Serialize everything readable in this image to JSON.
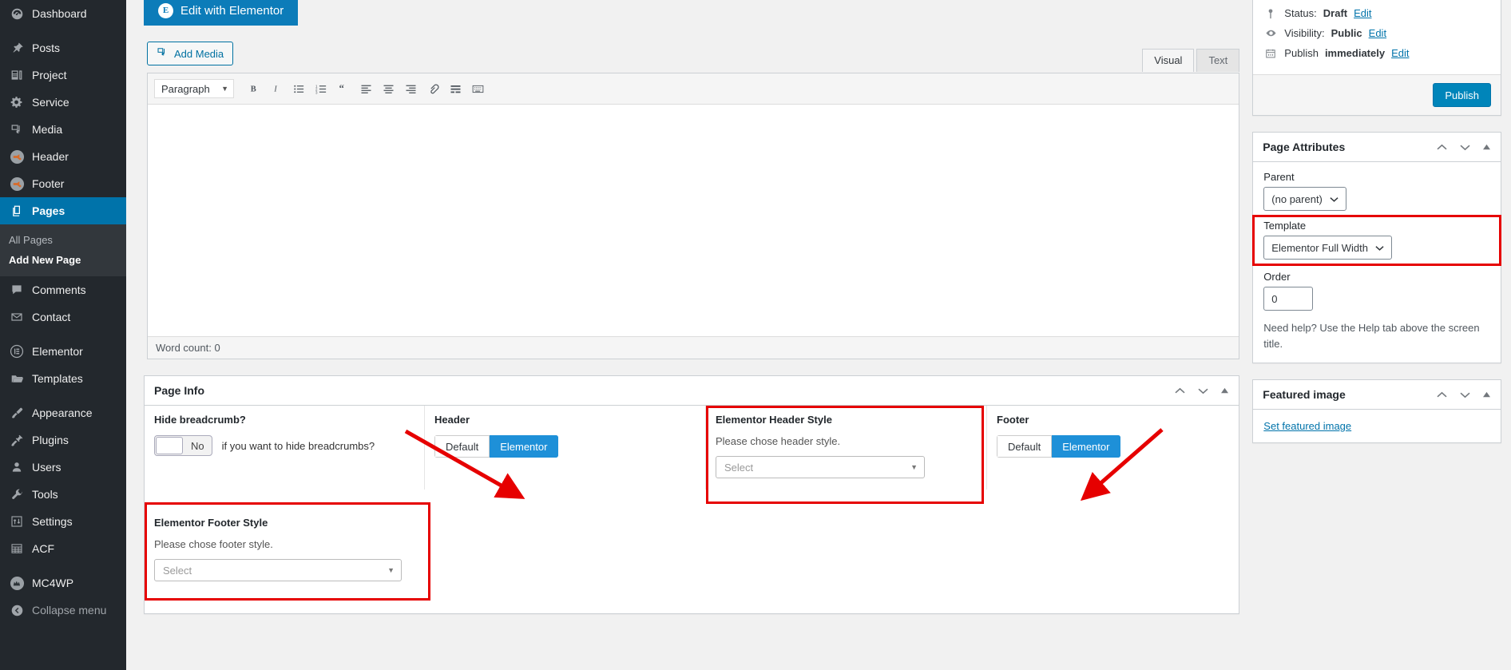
{
  "sidebar": {
    "items": [
      {
        "label": "Dashboard",
        "icon": "dashboard-icon",
        "gap_after": true
      },
      {
        "label": "Posts",
        "icon": "pin-icon"
      },
      {
        "label": "Project",
        "icon": "list-view-icon"
      },
      {
        "label": "Service",
        "icon": "gear-icon"
      },
      {
        "label": "Media",
        "icon": "media-icon"
      },
      {
        "label": "Header",
        "icon": "megaphone-icon"
      },
      {
        "label": "Footer",
        "icon": "megaphone-icon"
      },
      {
        "label": "Pages",
        "icon": "pages-icon",
        "active": true
      },
      {
        "label": "Comments",
        "icon": "comment-icon"
      },
      {
        "label": "Contact",
        "icon": "email-icon",
        "gap_after": true
      },
      {
        "label": "Elementor",
        "icon": "elementor-icon"
      },
      {
        "label": "Templates",
        "icon": "folder-icon",
        "gap_after": true
      },
      {
        "label": "Appearance",
        "icon": "brush-icon"
      },
      {
        "label": "Plugins",
        "icon": "plug-icon"
      },
      {
        "label": "Users",
        "icon": "user-icon"
      },
      {
        "label": "Tools",
        "icon": "wrench-icon"
      },
      {
        "label": "Settings",
        "icon": "settings-sliders-icon"
      },
      {
        "label": "ACF",
        "icon": "table-icon",
        "gap_after": true
      },
      {
        "label": "MC4WP",
        "icon": "mailchimp-icon"
      },
      {
        "label": "Collapse menu",
        "icon": "collapse-arrow-icon",
        "muted": true
      }
    ],
    "submenu": {
      "parent": "Pages",
      "items": [
        {
          "label": "All Pages",
          "current": false
        },
        {
          "label": "Add New Page",
          "current": true
        }
      ]
    }
  },
  "toolbar": {
    "edit_with_elementor": "Edit with Elementor",
    "elementor_mark": "E",
    "add_media": "Add Media"
  },
  "editor": {
    "tabs": [
      {
        "label": "Visual",
        "active": true
      },
      {
        "label": "Text",
        "active": false
      }
    ],
    "format_select": "Paragraph",
    "buttons": [
      {
        "name": "bold-icon",
        "glyph": "B"
      },
      {
        "name": "italic-icon",
        "glyph": "I"
      },
      {
        "name": "bulleted-list-icon",
        "glyph": "☰"
      },
      {
        "name": "numbered-list-icon",
        "glyph": "☰"
      },
      {
        "name": "blockquote-icon",
        "glyph": "“"
      },
      {
        "name": "align-left-icon",
        "glyph": "≡"
      },
      {
        "name": "align-center-icon",
        "glyph": "≡"
      },
      {
        "name": "align-right-icon",
        "glyph": "≡"
      },
      {
        "name": "insert-link-icon",
        "glyph": "🔗"
      },
      {
        "name": "read-more-icon",
        "glyph": "☰"
      },
      {
        "name": "toolbar-toggle-icon",
        "glyph": "⌨"
      }
    ],
    "word_count": "Word count: 0"
  },
  "page_info": {
    "title": "Page Info",
    "hide_breadcrumb": {
      "label": "Hide breadcrumb?",
      "toggle_value": "No",
      "hint": "if you want to hide breadcrumbs?"
    },
    "header": {
      "label": "Header",
      "options": [
        {
          "label": "Default",
          "active": false
        },
        {
          "label": "Elementor",
          "active": true
        }
      ]
    },
    "elementor_header_style": {
      "label": "Elementor Header Style",
      "desc": "Please chose header style.",
      "select_value": "Select",
      "highlighted": true
    },
    "footer": {
      "label": "Footer",
      "options": [
        {
          "label": "Default",
          "active": false
        },
        {
          "label": "Elementor",
          "active": true
        }
      ]
    },
    "elementor_footer_style": {
      "label": "Elementor Footer Style",
      "desc": "Please chose footer style.",
      "select_value": "Select",
      "highlighted": true
    }
  },
  "publish_panel": {
    "status_label": "Status:",
    "status_value": "Draft",
    "status_edit": "Edit",
    "visibility_label": "Visibility:",
    "visibility_value": "Public",
    "visibility_edit": "Edit",
    "schedule_label": "Publish",
    "schedule_value": "immediately",
    "schedule_edit": "Edit",
    "publish_button": "Publish"
  },
  "page_attributes": {
    "title": "Page Attributes",
    "parent_label": "Parent",
    "parent_value": "(no parent)",
    "template_label": "Template",
    "template_value": "Elementor Full Width",
    "template_highlighted": true,
    "order_label": "Order",
    "order_value": "0",
    "help_text": "Need help? Use the Help tab above the screen title."
  },
  "featured_image": {
    "title": "Featured image",
    "link": "Set featured image"
  },
  "colors": {
    "accent_blue": "#0073aa",
    "button_blue": "#1e90d8",
    "sidebar_bg": "#23282d",
    "submenu_bg": "#32373c",
    "highlight_red": "#e60000",
    "publish_blue": "#0085ba"
  }
}
